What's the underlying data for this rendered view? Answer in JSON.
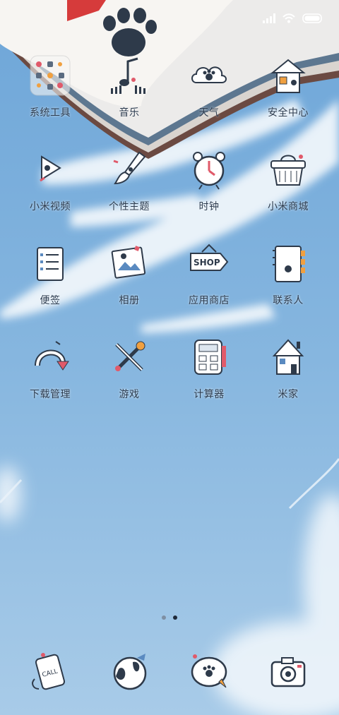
{
  "status_bar": {
    "signal_icon": "signal-icon",
    "wifi_icon": "wifi-icon",
    "battery_icon": "battery-icon"
  },
  "apps": [
    {
      "label": "系统工具",
      "icon": "tools-folder-icon"
    },
    {
      "label": "音乐",
      "icon": "music-icon"
    },
    {
      "label": "天气",
      "icon": "weather-icon"
    },
    {
      "label": "安全中心",
      "icon": "security-house-icon"
    },
    {
      "label": "小米视频",
      "icon": "video-play-icon"
    },
    {
      "label": "个性主题",
      "icon": "paintbrush-icon"
    },
    {
      "label": "时钟",
      "icon": "alarm-clock-icon"
    },
    {
      "label": "小米商城",
      "icon": "shopping-basket-icon"
    },
    {
      "label": "便签",
      "icon": "notepad-icon"
    },
    {
      "label": "相册",
      "icon": "photo-icon"
    },
    {
      "label": "应用商店",
      "icon": "shop-sign-icon"
    },
    {
      "label": "联系人",
      "icon": "contacts-book-icon"
    },
    {
      "label": "下载管理",
      "icon": "download-arrow-icon"
    },
    {
      "label": "游戏",
      "icon": "game-tools-icon"
    },
    {
      "label": "计算器",
      "icon": "calculator-icon"
    },
    {
      "label": "米家",
      "icon": "home-icon"
    }
  ],
  "page_indicator": {
    "pages": 2,
    "current": 2
  },
  "dock": [
    {
      "icon": "phone-call-icon",
      "text": "CALL"
    },
    {
      "icon": "browser-globe-icon"
    },
    {
      "icon": "messages-icon"
    },
    {
      "icon": "camera-icon"
    }
  ],
  "colors": {
    "sky": "#7fb0dc",
    "label": "#2d3c4f",
    "book_spine": "#5d7790"
  }
}
